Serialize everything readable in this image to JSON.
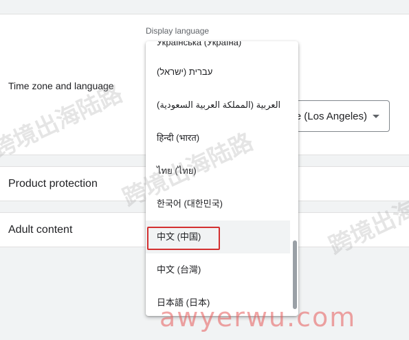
{
  "settings": {
    "time_zone_language_label": "Time zone and language",
    "product_protection_label": "Product protection",
    "adult_content_label": "Adult content"
  },
  "language_select": {
    "label": "Display language",
    "options": [
      {
        "label": "Українська (Україна)",
        "selected": false
      },
      {
        "label": "עברית (ישראל)",
        "selected": false
      },
      {
        "label": "العربية (المملكة العربية السعودية)",
        "selected": false
      },
      {
        "label": "हिन्दी (भारत)",
        "selected": false
      },
      {
        "label": "ไทย (ไทย)",
        "selected": false
      },
      {
        "label": "한국어 (대한민국)",
        "selected": false
      },
      {
        "label": "中文 (中国)",
        "selected": true
      },
      {
        "label": "中文 (台灣)",
        "selected": false
      },
      {
        "label": "日本語 (日本)",
        "selected": false
      }
    ]
  },
  "timezone_select": {
    "value": "ne (Los Angeles)"
  },
  "watermark": {
    "text": "跨境出海陆路",
    "footer": "awyerwu.com"
  },
  "colors": {
    "highlight": "#d32f2f",
    "background": "#f1f3f4"
  }
}
